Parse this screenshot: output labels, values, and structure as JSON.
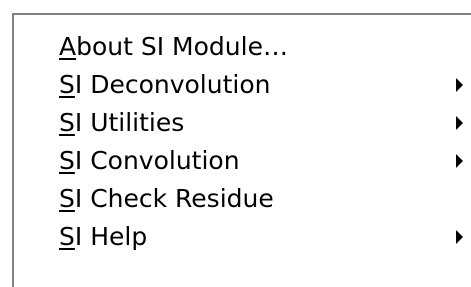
{
  "menu": {
    "items": [
      {
        "mnemonic": "A",
        "rest": "bout SI Module…",
        "has_submenu": false,
        "arrow_icon": ""
      },
      {
        "mnemonic": "S",
        "rest": "I Deconvolution",
        "has_submenu": true,
        "arrow_icon": "submenu-arrow-icon"
      },
      {
        "mnemonic": "S",
        "rest": "I Utilities",
        "has_submenu": true,
        "arrow_icon": "submenu-arrow-icon"
      },
      {
        "mnemonic": "S",
        "rest": "I Convolution",
        "has_submenu": true,
        "arrow_icon": "submenu-arrow-icon"
      },
      {
        "mnemonic": "S",
        "rest": "I Check Residue",
        "has_submenu": false,
        "arrow_icon": ""
      },
      {
        "mnemonic": "S",
        "rest": "I Help",
        "has_submenu": true,
        "arrow_icon": "submenu-arrow-icon"
      }
    ]
  }
}
